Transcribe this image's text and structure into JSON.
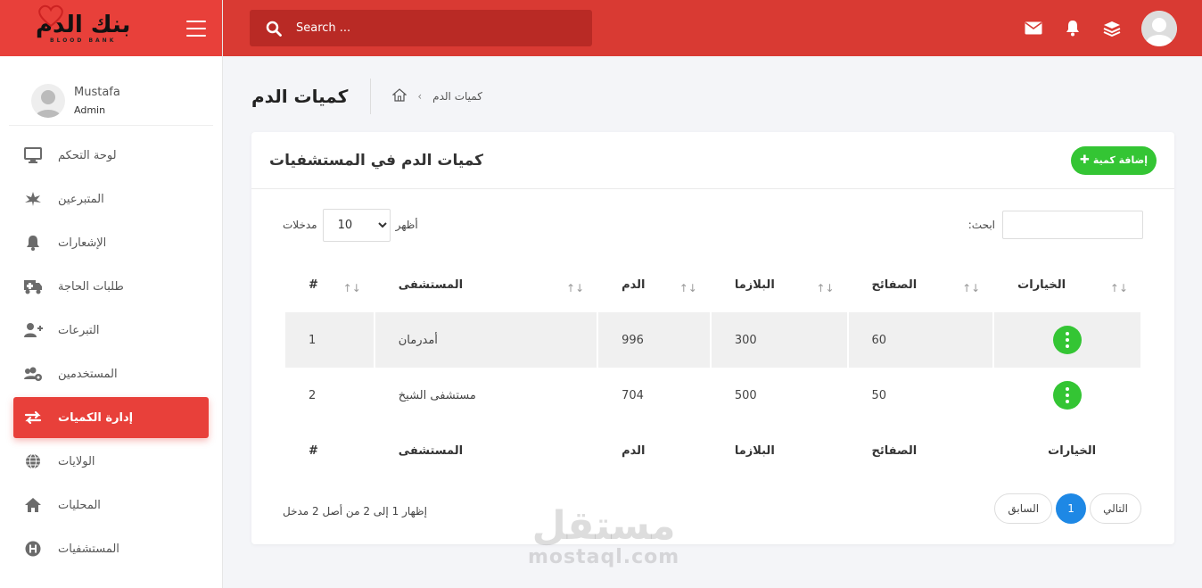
{
  "brand": {
    "logo_text": "بنك الدم",
    "logo_sub": "BLOOD BANK"
  },
  "user": {
    "name": "Mustafa",
    "role": "Admin"
  },
  "sidebar": {
    "items": [
      {
        "label": "لوحة التحكم",
        "icon": "monitor-icon"
      },
      {
        "label": "المتبرعين",
        "icon": "leaf-icon"
      },
      {
        "label": "الإشعارات",
        "icon": "bell-icon"
      },
      {
        "label": "طلبات الحاجة",
        "icon": "ambulance-icon"
      },
      {
        "label": "التبرعات",
        "icon": "user-plus-icon"
      },
      {
        "label": "المستخدمين",
        "icon": "users-cog-icon"
      },
      {
        "label": "إدارة الكميات",
        "icon": "exchange-icon",
        "active": true
      },
      {
        "label": "الولايات",
        "icon": "globe-icon"
      },
      {
        "label": "المحليات",
        "icon": "home-icon"
      },
      {
        "label": "المستشفيات",
        "icon": "hospital-icon"
      }
    ]
  },
  "topbar": {
    "search_placeholder": "Search ...",
    "icons": [
      "envelope-icon",
      "bell-icon",
      "layers-icon"
    ]
  },
  "page": {
    "title": "كميات الدم",
    "breadcrumb": "كميات الدم"
  },
  "card": {
    "title": "كميات الدم في المستشفيات",
    "add_button": "إضافة كمية"
  },
  "controls": {
    "show_label": "أظهر",
    "entries_label": "مدخلات",
    "page_length": "10",
    "search_label": ":ابحث"
  },
  "table": {
    "columns": [
      "#",
      "المستشفى",
      "الدم",
      "البلازما",
      "الصفائح",
      "الخيارات"
    ],
    "rows": [
      {
        "id": "1",
        "hospital": "أمدرمان",
        "blood": "996",
        "plasma": "300",
        "platelets": "60"
      },
      {
        "id": "2",
        "hospital": "مستشفى الشيخ",
        "blood": "704",
        "plasma": "500",
        "platelets": "50"
      }
    ]
  },
  "pagination": {
    "info": "إظهار 1 إلى 2 من أصل 2 مدخل",
    "prev": "السابق",
    "current": "1",
    "next": "التالي"
  },
  "watermark": {
    "arabic": "مستقل",
    "latin": "mostaql.com"
  },
  "colors": {
    "primary_red": "#e8403a",
    "topbar_red": "#d93a33",
    "search_bg": "#b92a25",
    "green": "#34c534",
    "blue": "#1e88e5"
  }
}
